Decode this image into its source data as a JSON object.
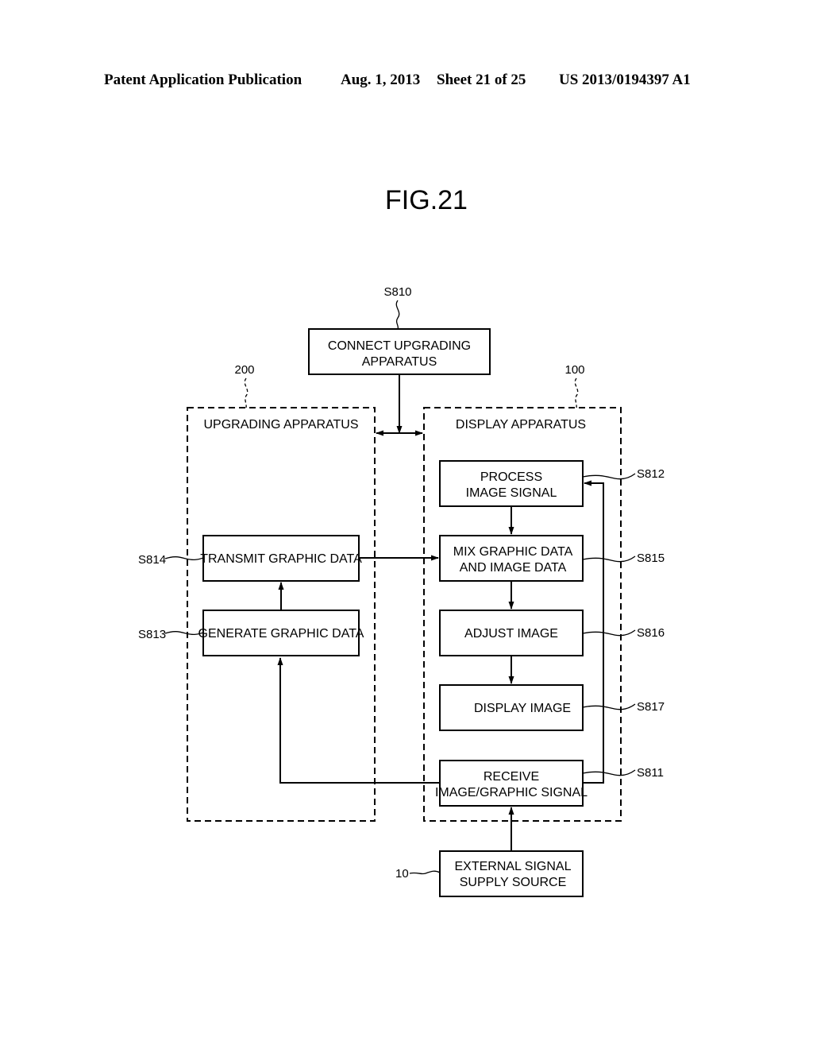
{
  "header": {
    "left": "Patent Application Publication",
    "date": "Aug. 1, 2013",
    "sheet": "Sheet 21 of 25",
    "pub_number": "US 2013/0194397 A1"
  },
  "figure": {
    "title": "FIG.21",
    "groups": {
      "upgrading": {
        "ref": "200",
        "label": "UPGRADING APPARATUS"
      },
      "display": {
        "ref": "100",
        "label": "DISPLAY APPARATUS"
      }
    },
    "steps": {
      "s810": {
        "ref": "S810",
        "line1": "CONNECT UPGRADING",
        "line2": "APPARATUS"
      },
      "s812": {
        "ref": "S812",
        "line1": "PROCESS",
        "line2": "IMAGE SIGNAL"
      },
      "s815": {
        "ref": "S815",
        "line1": "MIX GRAPHIC DATA",
        "line2": "AND IMAGE DATA"
      },
      "s816": {
        "ref": "S816",
        "line1": "ADJUST IMAGE"
      },
      "s817": {
        "ref": "S817",
        "line1": "DISPLAY IMAGE"
      },
      "s811": {
        "ref": "S811",
        "line1": "RECEIVE",
        "line2": "IMAGE/GRAPHIC SIGNAL"
      },
      "s814": {
        "ref": "S814",
        "line1": "TRANSMIT GRAPHIC DATA"
      },
      "s813": {
        "ref": "S813",
        "line1": "GENERATE GRAPHIC DATA"
      },
      "ext": {
        "ref": "10",
        "line1": "EXTERNAL SIGNAL",
        "line2": "SUPPLY SOURCE"
      }
    }
  }
}
